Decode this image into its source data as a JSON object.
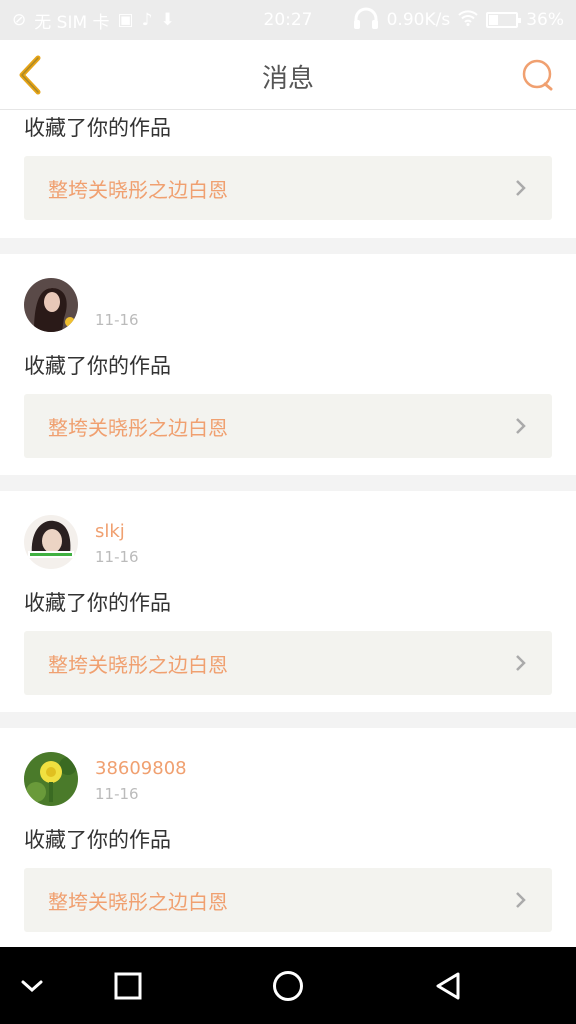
{
  "status_bar": {
    "sim_text": "无 SIM 卡",
    "time": "20:27",
    "speed": "0.90K/s",
    "battery": "36%",
    "battery_level": 0.36,
    "icons": [
      "no-signal-icon",
      "image-icon",
      "music-note-icon",
      "download-icon",
      "headphones-icon",
      "wifi-icon",
      "battery-icon"
    ]
  },
  "header": {
    "title": "消息",
    "back_icon": "back-chevron-icon",
    "search_icon": "search-icon"
  },
  "colors": {
    "accent": "#f0a070",
    "back_arrow": "#e6a417",
    "work_bg": "#f3f3ef",
    "page_bg": "#f3f3f3"
  },
  "partial_item": {
    "action": "收藏了你的作品",
    "work_title": "整垮关晓彤之边白恩"
  },
  "items": [
    {
      "username": "",
      "date": "11-16",
      "action": "收藏了你的作品",
      "work_title": "整垮关晓彤之边白恩"
    },
    {
      "username": "slkj",
      "date": "11-16",
      "action": "收藏了你的作品",
      "work_title": "整垮关晓彤之边白恩"
    },
    {
      "username": "38609808",
      "date": "11-16",
      "action": "收藏了你的作品",
      "work_title": "整垮关晓彤之边白恩"
    }
  ],
  "nav_bar": {
    "icons": [
      "collapse-icon",
      "recents-icon",
      "home-icon",
      "back-icon"
    ]
  }
}
